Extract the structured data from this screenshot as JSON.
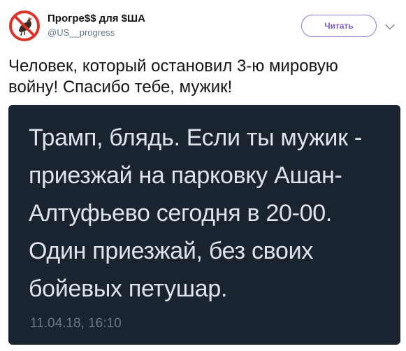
{
  "author": {
    "name": "Прогре$$ для $ША",
    "handle": "@US__progress",
    "avatar_icon": "no-rooster-avatar-icon"
  },
  "header": {
    "follow_label": "Читать",
    "menu_icon": "chevron-down-icon"
  },
  "tweet": {
    "lines": [
      "Человек, который остановил 3-ю мировую",
      "войну! Спасибо тебе, мужик!"
    ]
  },
  "media": {
    "lines": [
      "Трамп, блядь. Если ты мужик -",
      "приезжай на парковку Ашан-",
      "Алтуфьево сегодня в 20-00.",
      "Один приезжай, без своих",
      "бойевых петушар."
    ],
    "timestamp": "11.04.18, 16:10",
    "background_color": "#1a2330",
    "text_color": "#dfe3ea"
  },
  "colors": {
    "accent": "#7a5fd0",
    "prohibition_red": "#d9342b",
    "handle_gray": "#657786"
  }
}
